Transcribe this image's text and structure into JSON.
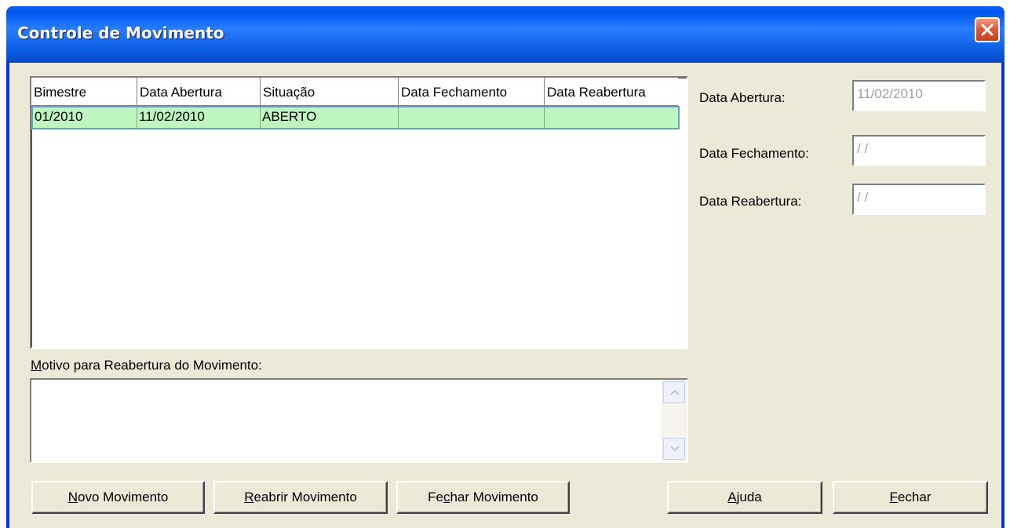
{
  "window": {
    "title": "Controle de Movimento"
  },
  "list": {
    "columns": [
      "Bimestre",
      "Data Abertura",
      "Situação",
      "Data Fechamento",
      "Data Reabertura"
    ],
    "rows": [
      [
        "01/2010",
        "11/02/2010",
        "ABERTO",
        "",
        ""
      ]
    ]
  },
  "motivo": {
    "label_accel": "M",
    "label_rest": "otivo para Reabertura do Movimento:",
    "value": ""
  },
  "fields": {
    "abertura": {
      "label": "Data Abertura:",
      "value": "11/02/2010"
    },
    "fechamento": {
      "label": "Data Fechamento:",
      "value": " / /"
    },
    "reabertura": {
      "label": "Data Reabertura:",
      "value": " / /"
    }
  },
  "buttons": {
    "novo": {
      "accel": "N",
      "rest": "ovo Movimento"
    },
    "reabrir": {
      "accel": "R",
      "rest": "eabrir Movimento"
    },
    "fechar_mov": {
      "pre": "Fe",
      "accel": "c",
      "rest": "har Movimento"
    },
    "ajuda": {
      "accel": "A",
      "rest": "juda"
    },
    "fechar": {
      "accel": "F",
      "rest": "echar"
    }
  },
  "colors": {
    "selection": "#bff5bf",
    "titlebar": "#0058ee",
    "dialog": "#ece9d8",
    "disabled_text": "#a0a0a0"
  }
}
